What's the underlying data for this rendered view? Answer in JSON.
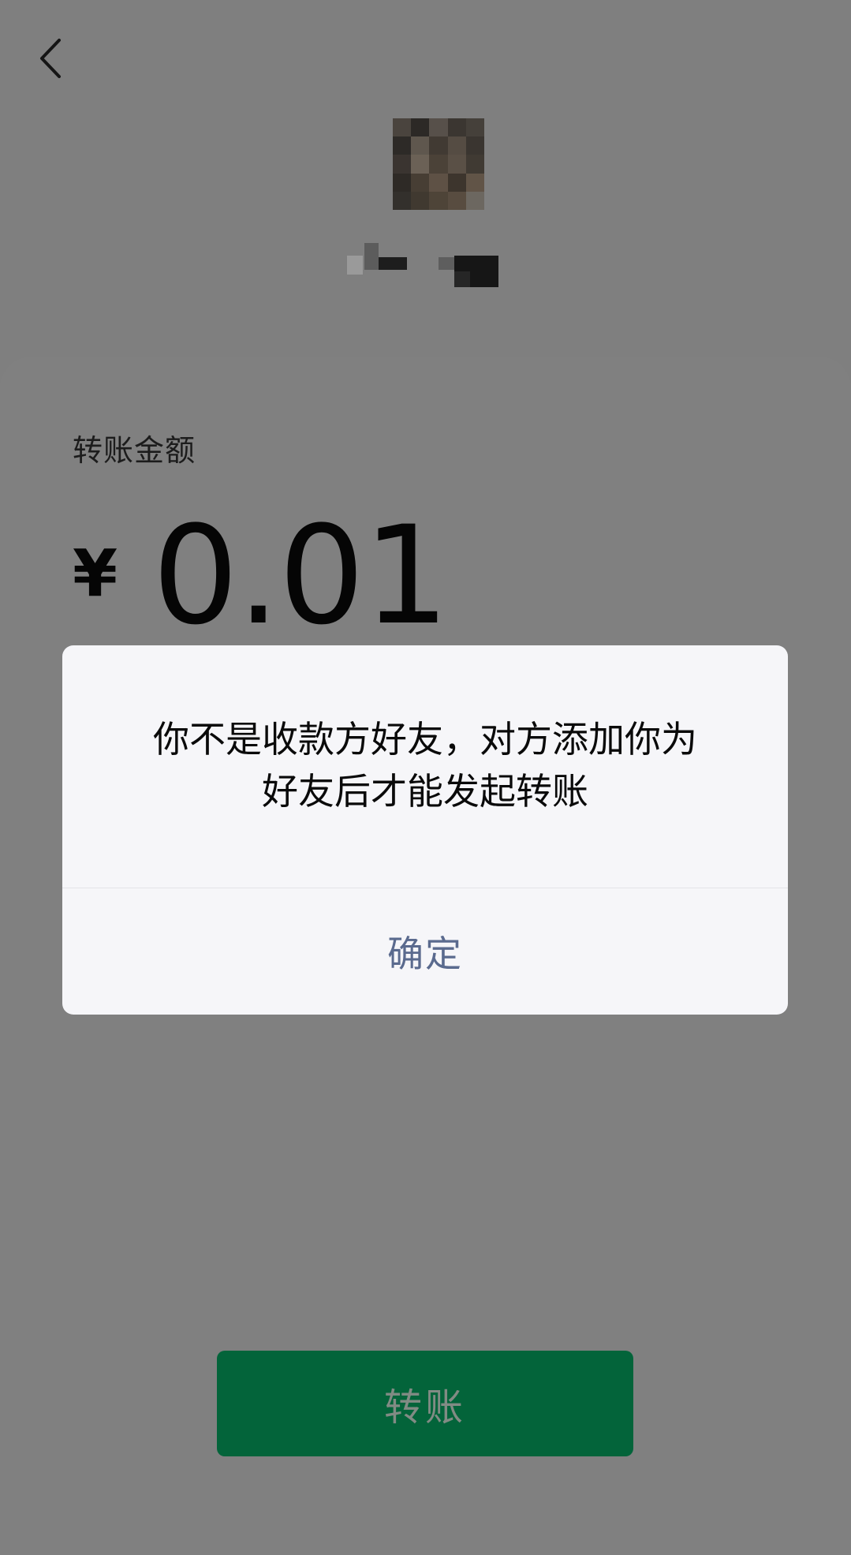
{
  "header": {
    "back_icon": "chevron-left-icon"
  },
  "payee": {
    "avatar": "pixelated-avatar",
    "name_obscured": true
  },
  "transfer": {
    "amount_label": "转账金额",
    "currency_symbol": "¥",
    "amount": "0.01",
    "button_label": "转账"
  },
  "dialog": {
    "message_line1": "你不是收款方好友，对方添加你为",
    "message_line2": "好友后才能发起转账",
    "confirm_label": "确定"
  },
  "colors": {
    "overlay_background": "#7f7f7f",
    "button_green_dimmed": "#03643a",
    "dialog_background": "#f6f6f9",
    "dialog_action_text": "#5a6a8e"
  }
}
